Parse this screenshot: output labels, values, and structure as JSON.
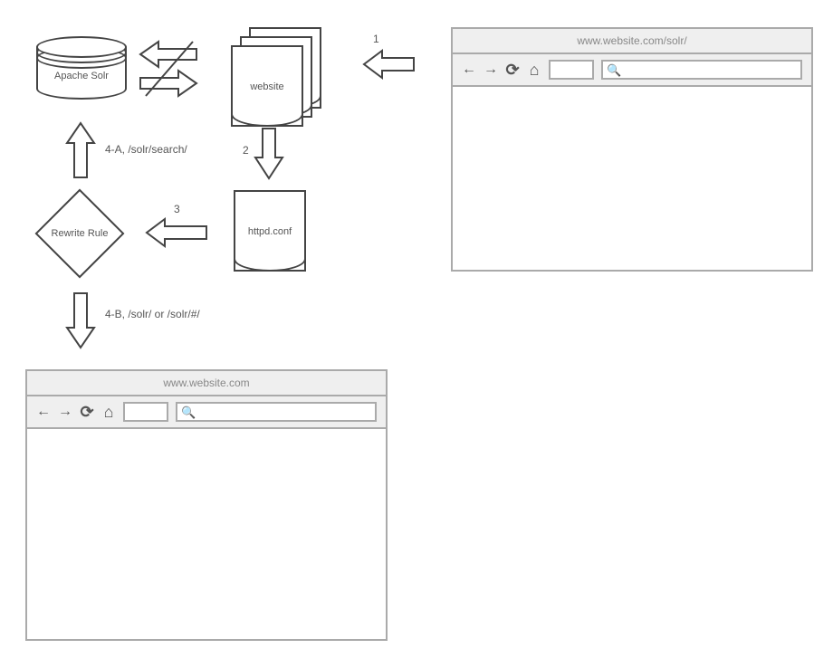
{
  "nodes": {
    "apache_solr_label": "Apache Solr",
    "website_label": "website",
    "httpd_conf_label": "httpd.conf",
    "rewrite_rule_label": "Rewrite Rule"
  },
  "steps": {
    "s1": "1",
    "s2": "2",
    "s3": "3",
    "s4a": "4-A, /solr/search/",
    "s4b": "4-B, /solr/ or /solr/#/"
  },
  "browsers": {
    "top_right_title": "www.website.com/solr/",
    "bottom_left_title": "www.website.com"
  },
  "icons": {
    "back": "←",
    "forward": "→",
    "reload": "⟳",
    "home": "⌂",
    "search": "🔍"
  }
}
